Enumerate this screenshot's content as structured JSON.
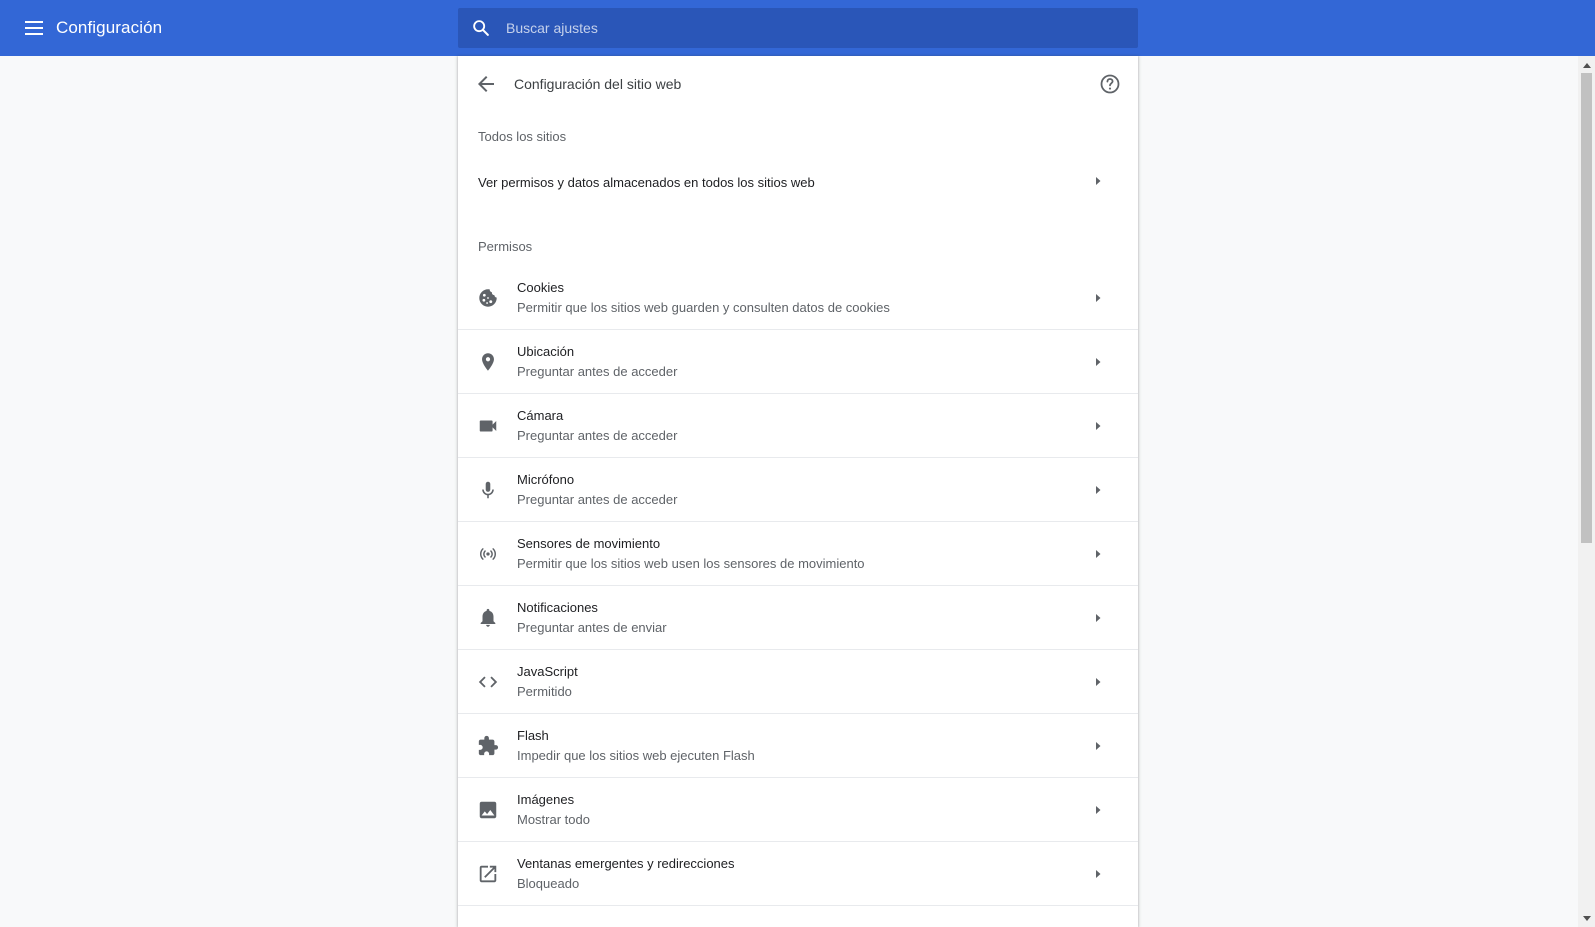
{
  "app": {
    "title": "Configuración"
  },
  "search": {
    "placeholder": "Buscar ajustes",
    "value": ""
  },
  "page": {
    "title": "Configuración del sitio web"
  },
  "all_sites": {
    "section_label": "Todos los sitios",
    "row_label": "Ver permisos y datos almacenados en todos los sitios web"
  },
  "permissions": {
    "section_label": "Permisos",
    "items": [
      {
        "icon": "cookie-icon",
        "title": "Cookies",
        "subtitle": "Permitir que los sitios web guarden y consulten datos de cookies"
      },
      {
        "icon": "location-pin-icon",
        "title": "Ubicación",
        "subtitle": "Preguntar antes de acceder"
      },
      {
        "icon": "camera-icon",
        "title": "Cámara",
        "subtitle": "Preguntar antes de acceder"
      },
      {
        "icon": "microphone-icon",
        "title": "Micrófono",
        "subtitle": "Preguntar antes de acceder"
      },
      {
        "icon": "motion-sensor-icon",
        "title": "Sensores de movimiento",
        "subtitle": "Permitir que los sitios web usen los sensores de movimiento"
      },
      {
        "icon": "bell-icon",
        "title": "Notificaciones",
        "subtitle": "Preguntar antes de enviar"
      },
      {
        "icon": "code-icon",
        "title": "JavaScript",
        "subtitle": "Permitido"
      },
      {
        "icon": "puzzle-icon",
        "title": "Flash",
        "subtitle": "Impedir que los sitios web ejecuten Flash"
      },
      {
        "icon": "image-icon",
        "title": "Imágenes",
        "subtitle": "Mostrar todo"
      },
      {
        "icon": "open-in-new-icon",
        "title": "Ventanas emergentes y redirecciones",
        "subtitle": "Bloqueado"
      }
    ]
  },
  "colors": {
    "toolbar": "#3367d6",
    "search_bg": "#2a56b8",
    "icon": "#5f6368",
    "background": "#f8f9fa"
  }
}
